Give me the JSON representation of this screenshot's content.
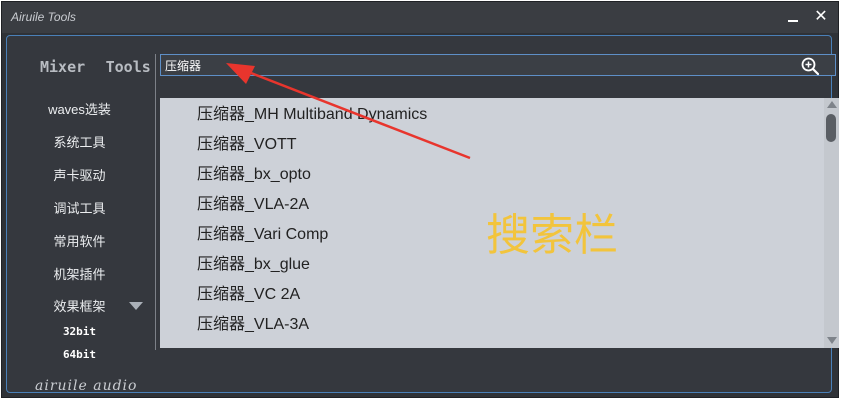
{
  "window": {
    "title": "Airuile Tools",
    "minimize_label": "—",
    "close_label": "✕"
  },
  "tabs": [
    "Mixer",
    "Tools"
  ],
  "sidebar": {
    "items": [
      "waves选装",
      "系统工具",
      "声卡驱动",
      "调试工具",
      "常用软件",
      "机架插件",
      "效果框架"
    ],
    "sub_items": [
      "32bit",
      "64bit"
    ],
    "brand": "airuile audio"
  },
  "search": {
    "value": "压缩器",
    "placeholder": ""
  },
  "results": [
    "压缩器_MH Multiband Dynamics",
    "压缩器_VOTT",
    "压缩器_bx_opto",
    "压缩器_VLA-2A",
    "压缩器_Vari Comp",
    "压缩器_bx_glue",
    "压缩器_VC 2A",
    "压缩器_VLA-3A"
  ],
  "annotation": {
    "text": "搜索栏",
    "color": "#f2c43c",
    "arrow_color": "#e8352d"
  },
  "colors": {
    "window_bg": "#2f3237",
    "accent_border": "#4a80b8",
    "list_bg": "#cdd1d8"
  }
}
